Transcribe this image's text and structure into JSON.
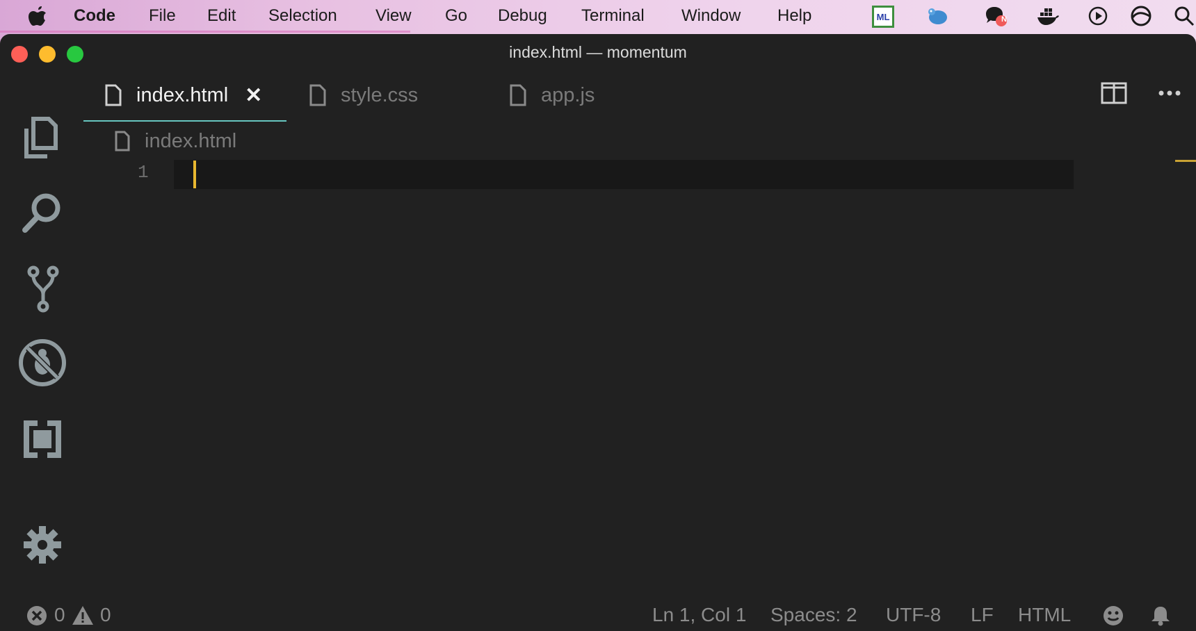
{
  "menubar": {
    "app_name": "Code",
    "items": [
      "File",
      "Edit",
      "Selection",
      "View",
      "Go",
      "Debug",
      "Terminal",
      "Window",
      "Help"
    ],
    "tray_icons": [
      "ml-icon",
      "bird-icon",
      "chat-notification-icon",
      "docker-icon",
      "play-circle-icon",
      "circle-arc-icon",
      "search-icon"
    ],
    "chat_badge": "N",
    "ml_label": "ML"
  },
  "window": {
    "title": "index.html — momentum"
  },
  "tabs": [
    {
      "label": "index.html",
      "active": true
    },
    {
      "label": "style.css",
      "active": false
    },
    {
      "label": "app.js",
      "active": false
    }
  ],
  "tab_close": "✕",
  "breadcrumb": {
    "file": "index.html"
  },
  "editor": {
    "line_numbers": [
      "1"
    ]
  },
  "statusbar": {
    "errors": "0",
    "warnings": "0",
    "position": "Ln 1, Col 1",
    "spaces": "Spaces: 2",
    "encoding": "UTF-8",
    "eol": "LF",
    "language": "HTML"
  },
  "colors": {
    "editor_bg": "#212121",
    "accent_tab": "#67c6c0",
    "cursor": "#e8b730"
  }
}
